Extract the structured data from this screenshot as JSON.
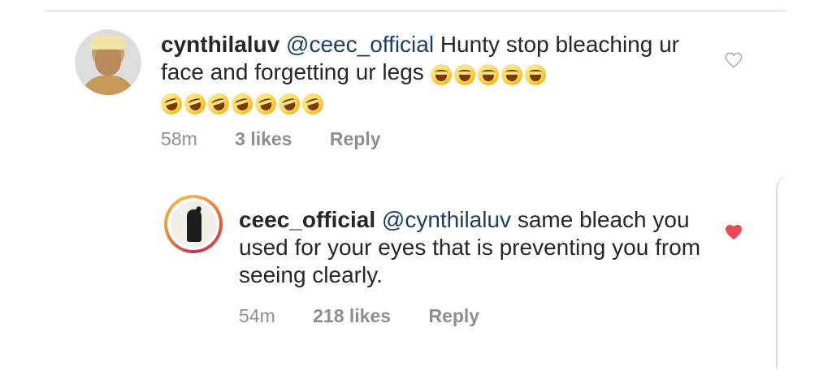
{
  "comments": [
    {
      "username": "cynthilaluv",
      "mention": "@ceec_official",
      "text": "Hunty stop bleaching ur face and forgetting ur legs",
      "emojis_line1": [
        "grinning-squinting-face",
        "grinning-squinting-face",
        "grinning-squinting-face",
        "grinning-squinting-face",
        "grinning-squinting-face"
      ],
      "emojis_line2": [
        "rofl-face",
        "rofl-face",
        "rofl-face",
        "rofl-face",
        "rofl-face",
        "rofl-face",
        "rofl-face"
      ],
      "time": "58m",
      "likes": "3 likes",
      "reply": "Reply",
      "liked": false,
      "heart_color": "#a8a8a8"
    },
    {
      "username": "ceec_official",
      "mention": "@cynthilaluv",
      "text": "same bleach you used for your eyes that is preventing you from seeing clearly.",
      "time": "54m",
      "likes": "218 likes",
      "reply": "Reply",
      "liked": true,
      "heart_color": "#ed4956"
    }
  ],
  "colors": {
    "text": "#262626",
    "meta": "#8e8e8e",
    "mention": "#1d3f66"
  },
  "icons": {
    "like": "heart-icon"
  }
}
